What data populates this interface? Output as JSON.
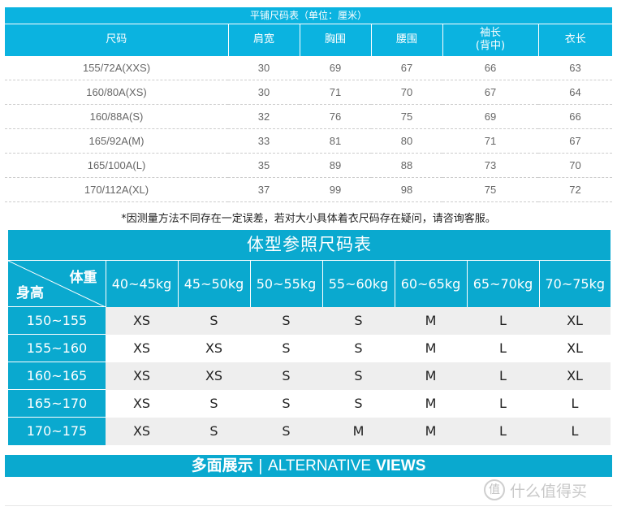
{
  "flat_chart": {
    "title": "平铺尺码表（单位：厘米）",
    "headers": [
      "尺码",
      "肩宽",
      "胸围",
      "腰围",
      "袖长\n(背中)",
      "衣长"
    ],
    "header_sleeve_line1": "袖长",
    "header_sleeve_line2": "(背中)",
    "rows": [
      [
        "155/72A(XXS)",
        "30",
        "69",
        "67",
        "66",
        "63"
      ],
      [
        "160/80A(XS)",
        "30",
        "71",
        "70",
        "67",
        "64"
      ],
      [
        "160/88A(S)",
        "32",
        "76",
        "75",
        "69",
        "66"
      ],
      [
        "165/92A(M)",
        "33",
        "81",
        "80",
        "71",
        "67"
      ],
      [
        "165/100A(L)",
        "35",
        "89",
        "88",
        "73",
        "70"
      ],
      [
        "170/112A(XL)",
        "37",
        "99",
        "98",
        "75",
        "72"
      ]
    ]
  },
  "note": "*因测量方法不同存在一定误差，若对大小具体着衣尺码存在疑问，请咨询客服。",
  "body_chart": {
    "title": "体型参照尺码表",
    "corner_weight": "体重",
    "corner_height": "身高",
    "weights": [
      "40~45kg",
      "45~50kg",
      "50~55kg",
      "55~60kg",
      "60~65kg",
      "65~70kg",
      "70~75kg"
    ],
    "rows": [
      {
        "height": "150~155",
        "sizes": [
          "XS",
          "S",
          "S",
          "S",
          "M",
          "L",
          "XL"
        ]
      },
      {
        "height": "155~160",
        "sizes": [
          "XS",
          "XS",
          "S",
          "S",
          "M",
          "L",
          "XL"
        ]
      },
      {
        "height": "160~165",
        "sizes": [
          "XS",
          "XS",
          "S",
          "S",
          "M",
          "L",
          "XL"
        ]
      },
      {
        "height": "165~170",
        "sizes": [
          "XS",
          "S",
          "S",
          "S",
          "M",
          "L",
          "L"
        ]
      },
      {
        "height": "170~175",
        "sizes": [
          "XS",
          "S",
          "S",
          "M",
          "M",
          "L",
          "L"
        ]
      }
    ]
  },
  "banner": {
    "cn": "多面展示",
    "separator": "|",
    "en_light": "ALTERNATIVE",
    "en_bold": "VIEWS"
  },
  "watermark": {
    "logo": "值",
    "text": "什么值得买"
  },
  "colors": {
    "flat_header": "#0bb3e0",
    "body_header": "#0aa9cf",
    "stripe": "#eeeeee"
  }
}
